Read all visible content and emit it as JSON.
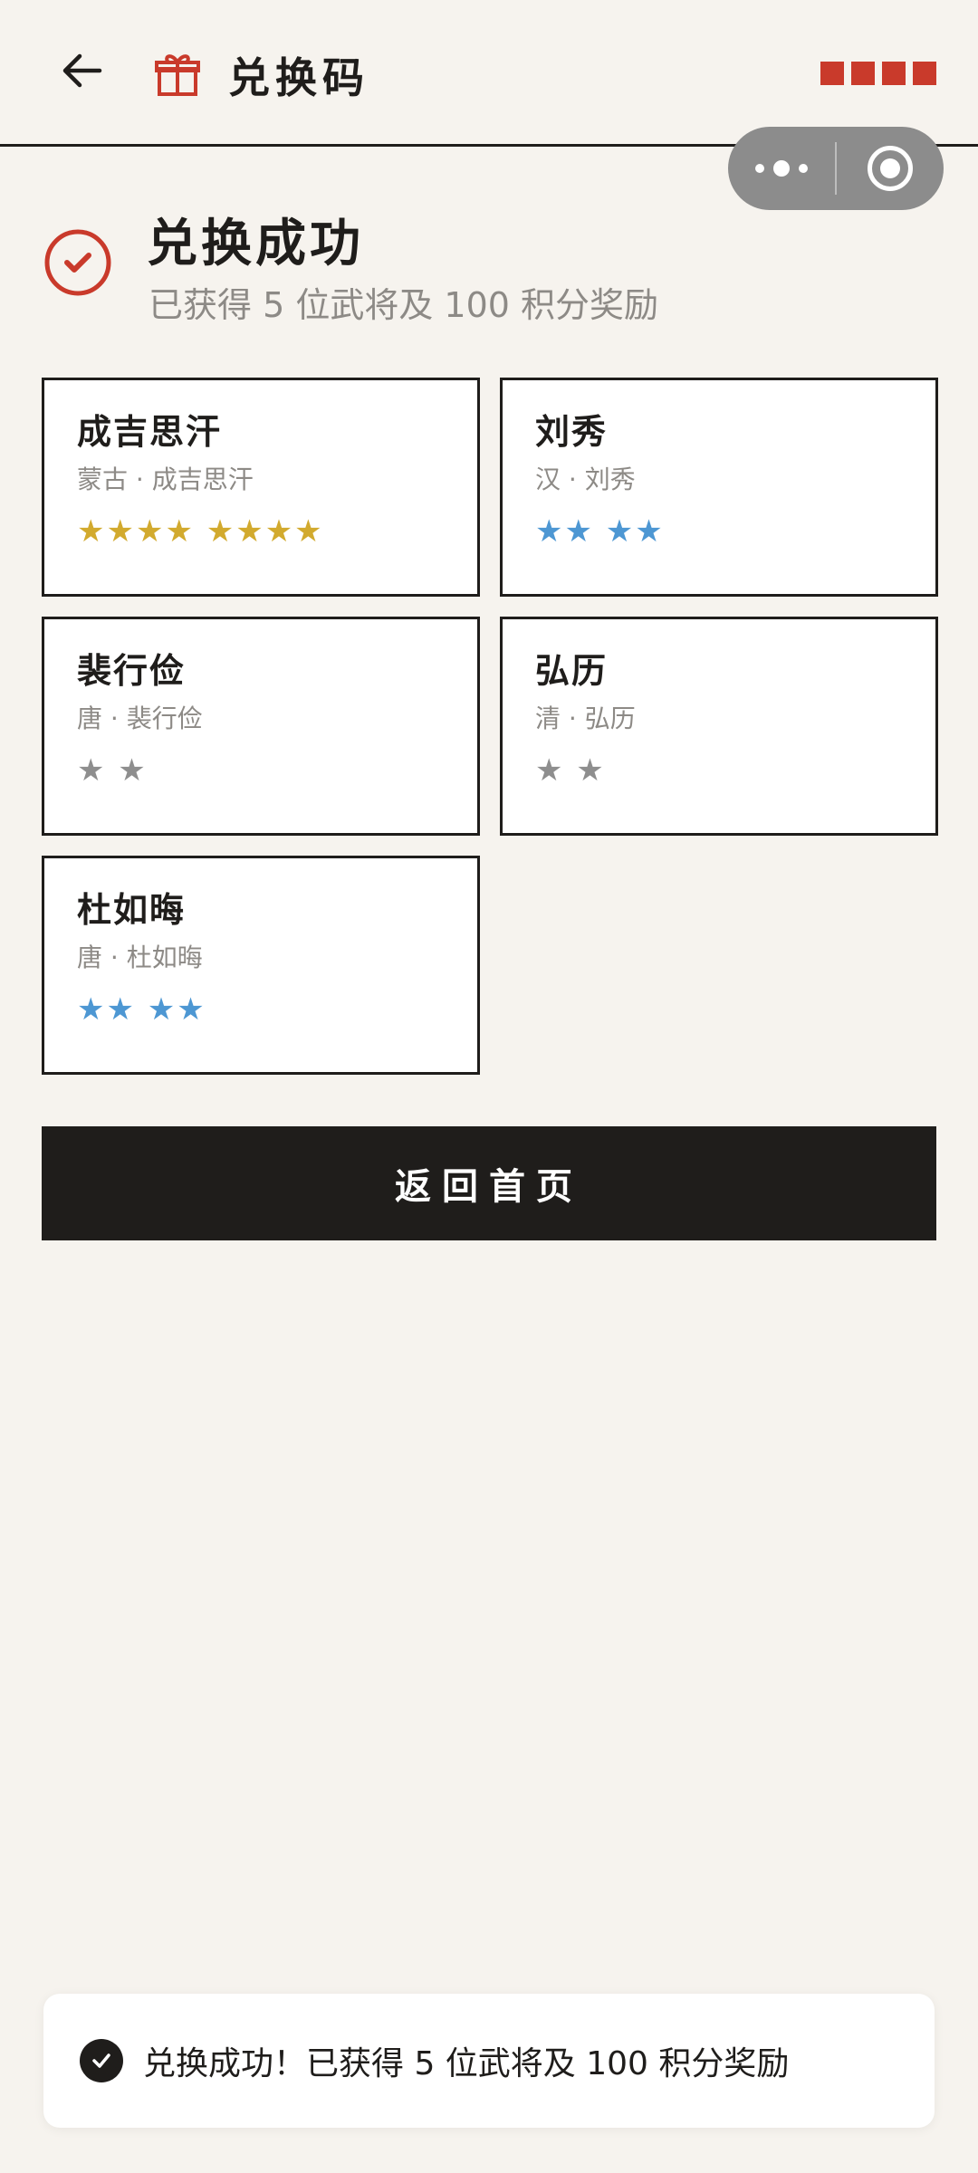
{
  "header": {
    "title": "兑换码",
    "back_icon": "arrow-left-icon",
    "gift_icon": "gift-icon",
    "brand_color": "#c93a2b"
  },
  "capsule": {
    "more_icon": "more-dots-icon",
    "close_icon": "close-target-icon"
  },
  "success": {
    "title": "兑换成功",
    "subtitle": "已获得 5 位武将及 100 积分奖励",
    "icon": "check-circle-icon",
    "icon_color": "#c93a2b"
  },
  "cards": [
    {
      "name": "成吉思汗",
      "sub": "蒙古 · 成吉思汗",
      "stars": "★★★★ ★★★★",
      "star_color": "#d2aa2e"
    },
    {
      "name": "刘秀",
      "sub": "汉 · 刘秀",
      "stars": "★★ ★★",
      "star_color": "#4d97d3"
    },
    {
      "name": "裴行俭",
      "sub": "唐 · 裴行俭",
      "stars": "★ ★",
      "star_color": "#8e8e8e"
    },
    {
      "name": "弘历",
      "sub": "清 · 弘历",
      "stars": "★ ★",
      "star_color": "#8e8e8e"
    },
    {
      "name": "杜如晦",
      "sub": "唐 · 杜如晦",
      "stars": "★★ ★★",
      "star_color": "#4d97d3"
    }
  ],
  "actions": {
    "home_label": "返回首页"
  },
  "toast": {
    "text": "兑换成功！已获得 5 位武将及 100 积分奖励",
    "icon": "check-icon"
  },
  "colors": {
    "background": "#f6f3ee",
    "ink": "#1f1d1b",
    "muted": "#8d8a86"
  }
}
